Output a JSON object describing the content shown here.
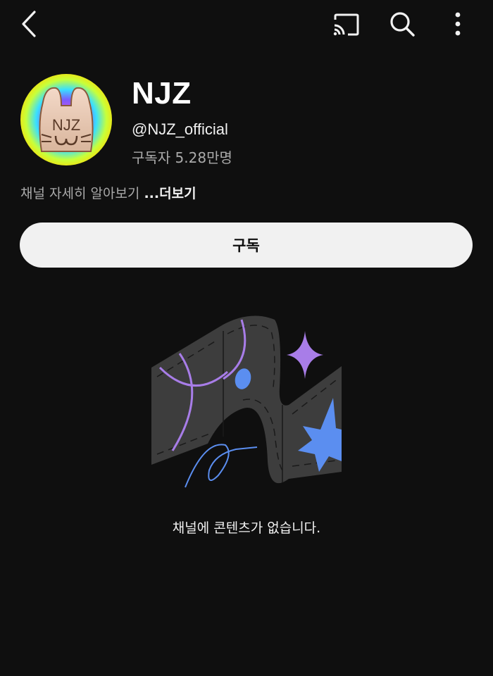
{
  "header": {
    "back_icon": "chevron-left-icon",
    "cast_icon": "cast-icon",
    "search_icon": "search-icon",
    "more_icon": "more-vertical-icon"
  },
  "channel": {
    "name": "NJZ",
    "handle": "@NJZ_official",
    "subscribers": "구독자 5.28만명",
    "description": "채널 자세히 알아보기",
    "more_label": "...더보기",
    "subscribe_label": "구독"
  },
  "empty_state": {
    "message": "채널에 콘텐츠가 없습니다."
  },
  "colors": {
    "background": "#0f0f0f",
    "primary_text": "#f1f1f1",
    "secondary_text": "#aaaaaa",
    "button_bg": "#f1f1f1",
    "accent_purple": "#a87de8",
    "accent_blue": "#5b8ef0"
  }
}
